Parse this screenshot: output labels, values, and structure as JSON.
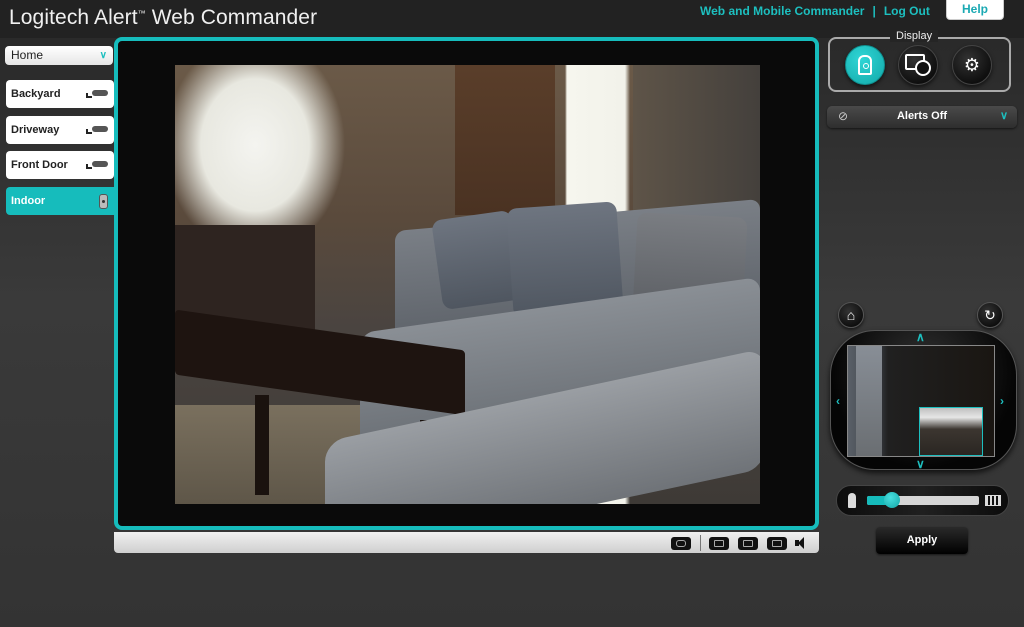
{
  "header": {
    "title": "Logitech Alert",
    "trademark": "™",
    "title_suffix": " Web Commander",
    "links": {
      "commander": "Web and Mobile Commander",
      "separator": "|",
      "logout": "Log Out"
    },
    "help_label": "Help"
  },
  "sidebar": {
    "location_select": {
      "value": "Home",
      "icon": "chevron-down-icon"
    },
    "cameras": [
      {
        "label": "Backyard",
        "icon": "outdoor-camera-icon",
        "active": false
      },
      {
        "label": "Driveway",
        "icon": "outdoor-camera-icon",
        "active": false
      },
      {
        "label": "Front Door",
        "icon": "outdoor-camera-icon",
        "active": false
      },
      {
        "label": "Indoor",
        "icon": "indoor-camera-icon",
        "active": true
      }
    ]
  },
  "video": {
    "toolbar": [
      {
        "name": "snapshot",
        "icon": "camera-snapshot-icon"
      },
      {
        "name": "fullscreen",
        "icon": "fullscreen-icon"
      },
      {
        "name": "popout",
        "icon": "popout-icon"
      },
      {
        "name": "popout-alt",
        "icon": "external-window-icon"
      },
      {
        "name": "audio",
        "icon": "speaker-icon"
      }
    ]
  },
  "right_panel": {
    "display_label": "Display",
    "display_buttons": [
      {
        "name": "live-view",
        "icon": "camera-icon",
        "active": true
      },
      {
        "name": "recordings",
        "icon": "film-clock-icon",
        "active": false
      },
      {
        "name": "settings",
        "icon": "gears-icon",
        "active": false
      }
    ],
    "alerts": {
      "label": "Alerts Off",
      "icon": "alerts-off-icon"
    },
    "ptz": {
      "home_icon": "home-icon",
      "reset_icon": "undo-icon"
    },
    "zoom": {
      "level": 0.22
    },
    "apply_label": "Apply"
  },
  "colors": {
    "accent": "#16bcbc",
    "link": "#1dbfbf",
    "background": "#2e2e2e"
  }
}
